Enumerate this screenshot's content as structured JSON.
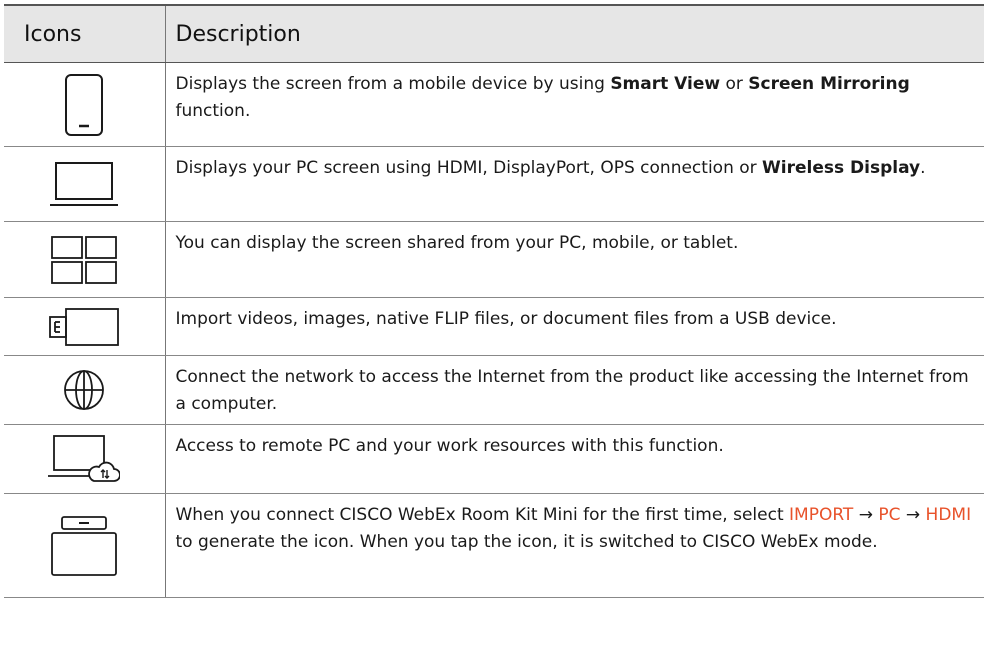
{
  "header": {
    "icons_label": "Icons",
    "description_label": "Description"
  },
  "rows": [
    {
      "icon": "mobile-device-icon",
      "pre": "Displays the screen from a mobile device by using ",
      "b1": "Smart View",
      "mid": " or ",
      "b2": "Screen Mirroring",
      "post": " function."
    },
    {
      "icon": "pc-monitor-icon",
      "pre": "Displays your PC screen using HDMI, DisplayPort, OPS connection or ",
      "b1": "Wireless Display",
      "post": "."
    },
    {
      "icon": "multi-screen-grid-icon",
      "text": "You can display the screen shared from your PC, mobile, or tablet."
    },
    {
      "icon": "usb-device-icon",
      "text": "Import videos, images, native FLIP files, or document files from a USB device."
    },
    {
      "icon": "globe-icon",
      "text": "Connect the network to access the Internet from the product like accessing the Internet from a computer."
    },
    {
      "icon": "remote-pc-cloud-icon",
      "text": "Access to remote PC and your work resources with this function."
    },
    {
      "icon": "cisco-webex-device-icon",
      "pre": "When you connect CISCO WebEx Room Kit Mini for the first time, select ",
      "a1": "IMPORT",
      "arrow1": " → ",
      "a2": "PC",
      "arrow2": " → ",
      "a3": "HDMI",
      "post": " to generate the icon. When you tap the icon, it is switched to CISCO WebEx mode."
    }
  ],
  "colors": {
    "accent": "#e8522a",
    "header_bg": "#e6e6e6",
    "border": "#777777"
  }
}
